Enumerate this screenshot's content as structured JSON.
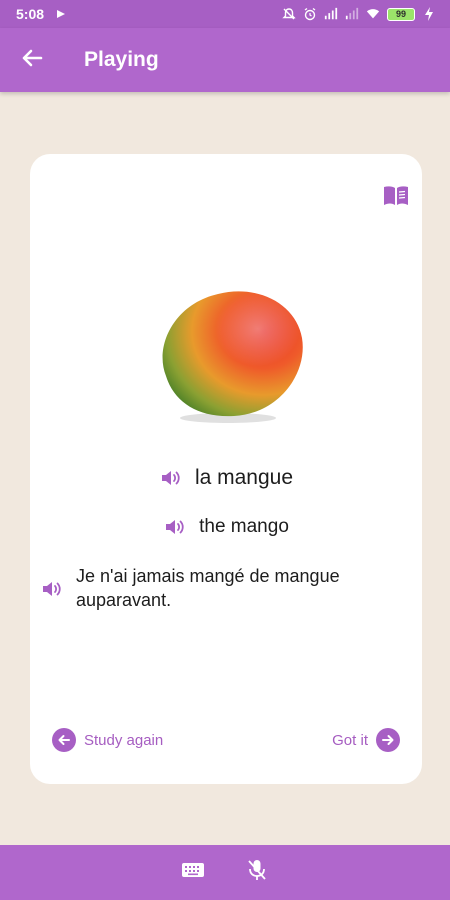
{
  "status_bar": {
    "time": "5:08",
    "battery_level": "99"
  },
  "app_bar": {
    "title": "Playing"
  },
  "card": {
    "word": "la mangue",
    "translation": "the mango",
    "sentence": "Je n'ai jamais mangé de mangue auparavant.",
    "study_again_label": "Study again",
    "got_it_label": "Got it",
    "image_subject": "mango"
  },
  "icons": {
    "back": "arrow-left-icon",
    "dictionary": "book-icon",
    "speaker": "volume-icon",
    "keyboard": "keyboard-icon",
    "mic_off": "mic-off-icon"
  },
  "colors": {
    "primary": "#b067cc",
    "primary_dark": "#a75fc4",
    "background": "#f1e8de",
    "card": "#ffffff"
  }
}
